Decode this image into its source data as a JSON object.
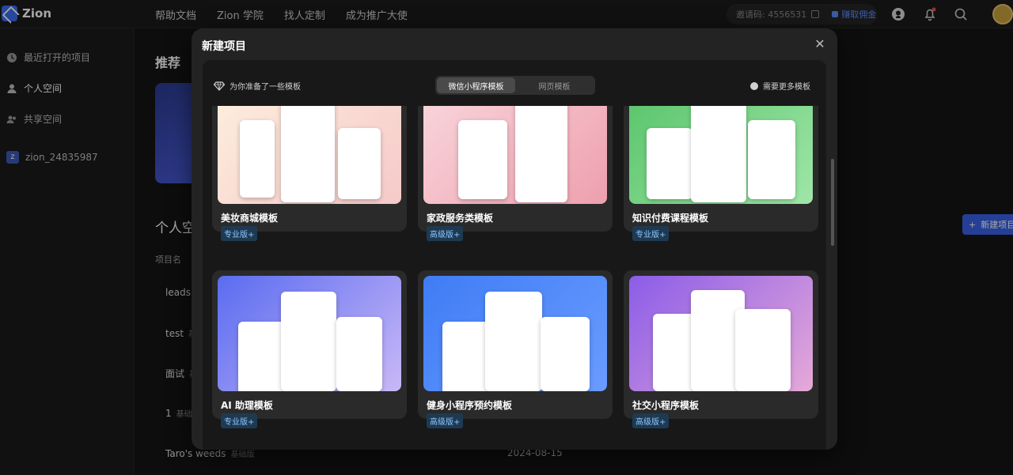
{
  "topbar": {
    "logo": "Zion",
    "nav": [
      "帮助文档",
      "Zion 学院",
      "找人定制",
      "成为推广大使"
    ],
    "invite_label": "邀请码: 4556531",
    "earn_label": "赚取佣金"
  },
  "sidebar": {
    "items": [
      {
        "label": "最近打开的项目",
        "icon": "clock-icon"
      },
      {
        "label": "个人空间",
        "icon": "user-icon"
      },
      {
        "label": "共享空间",
        "icon": "users-icon"
      }
    ],
    "user": {
      "badge": "z",
      "name": "zion_24835987"
    }
  },
  "main": {
    "recommend_title": "推荐",
    "space_title": "个人空",
    "col_head": "项目名",
    "new_button": "新建项目",
    "projects": [
      {
        "name": "leads",
        "tag": ""
      },
      {
        "name": "test",
        "tag": "基"
      },
      {
        "name": "面试",
        "tag": "基"
      },
      {
        "name": "1",
        "tag": "基础"
      },
      {
        "name": "Taro's weeds",
        "tag": "基础版"
      }
    ],
    "last_date": "2024-08-15"
  },
  "modal": {
    "title": "新建项目",
    "hint": "为你准备了一些模板",
    "tabs": [
      {
        "label": "微信小程序模板",
        "active": true
      },
      {
        "label": "网页模板",
        "active": false
      }
    ],
    "more": "需要更多模板",
    "templates": [
      {
        "name": "美妆商城模板",
        "badge": "专业版+",
        "bg": "linear-gradient(135deg,#fdeedd,#f6c9c9)"
      },
      {
        "name": "家政服务类模板",
        "badge": "高级版+",
        "bg": "linear-gradient(135deg,#f9d6dc,#ee9fae)"
      },
      {
        "name": "知识付费课程模板",
        "badge": "专业版+",
        "bg": "linear-gradient(135deg,#59c46a,#9fe6a8)"
      },
      {
        "name": "AI 助理模板",
        "badge": "专业版+",
        "bg": "linear-gradient(135deg,#5a6cf0,#c9b8f7)"
      },
      {
        "name": "健身小程序预约模板",
        "badge": "高级版+",
        "bg": "linear-gradient(135deg,#3f7cf5,#6a9cff)"
      },
      {
        "name": "社交小程序模板",
        "badge": "高级版+",
        "bg": "linear-gradient(135deg,#8b5ce8,#e6a9d8)"
      }
    ]
  }
}
